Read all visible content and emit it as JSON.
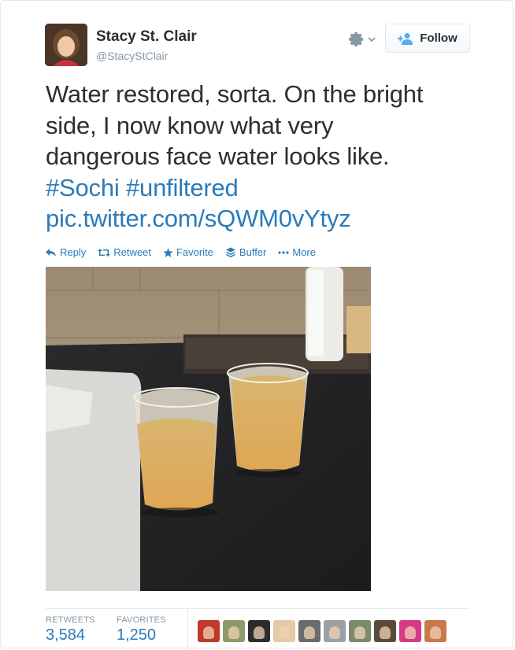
{
  "author": {
    "name": "Stacy St. Clair",
    "handle": "@StacyStClair"
  },
  "header": {
    "follow_label": "Follow",
    "gear_icon": "gear-icon"
  },
  "tweet": {
    "line1": "Water restored, sorta. On the bright",
    "line2": "side, I now know what very",
    "line3": "dangerous face water looks like.",
    "hashtag1": "#Sochi",
    "hashtag2": "#unfiltered",
    "link": "pic.twitter.com/sQWM0vYtyz"
  },
  "actions": [
    {
      "label": "Reply",
      "icon": "reply-icon"
    },
    {
      "label": "Retweet",
      "icon": "retweet-icon"
    },
    {
      "label": "Favorite",
      "icon": "star-icon"
    },
    {
      "label": "Buffer",
      "icon": "buffer-icon"
    },
    {
      "label": "More",
      "icon": "more-icon"
    }
  ],
  "stats": {
    "retweets_label": "RETWEETS",
    "retweets_value": "3,584",
    "favorites_label": "FAVORITES",
    "favorites_value": "1,250"
  },
  "colors": {
    "link": "#2b7bb9",
    "text": "#292f33",
    "muted": "#8899a6"
  },
  "faces": [
    "#c0392b",
    "#8e9a6a",
    "#2c2c2c",
    "#e6c9a8",
    "#6b6b6b",
    "#9aa0a6",
    "#7a8a6a",
    "#5a4a3a",
    "#d63a86",
    "#c8794a"
  ]
}
